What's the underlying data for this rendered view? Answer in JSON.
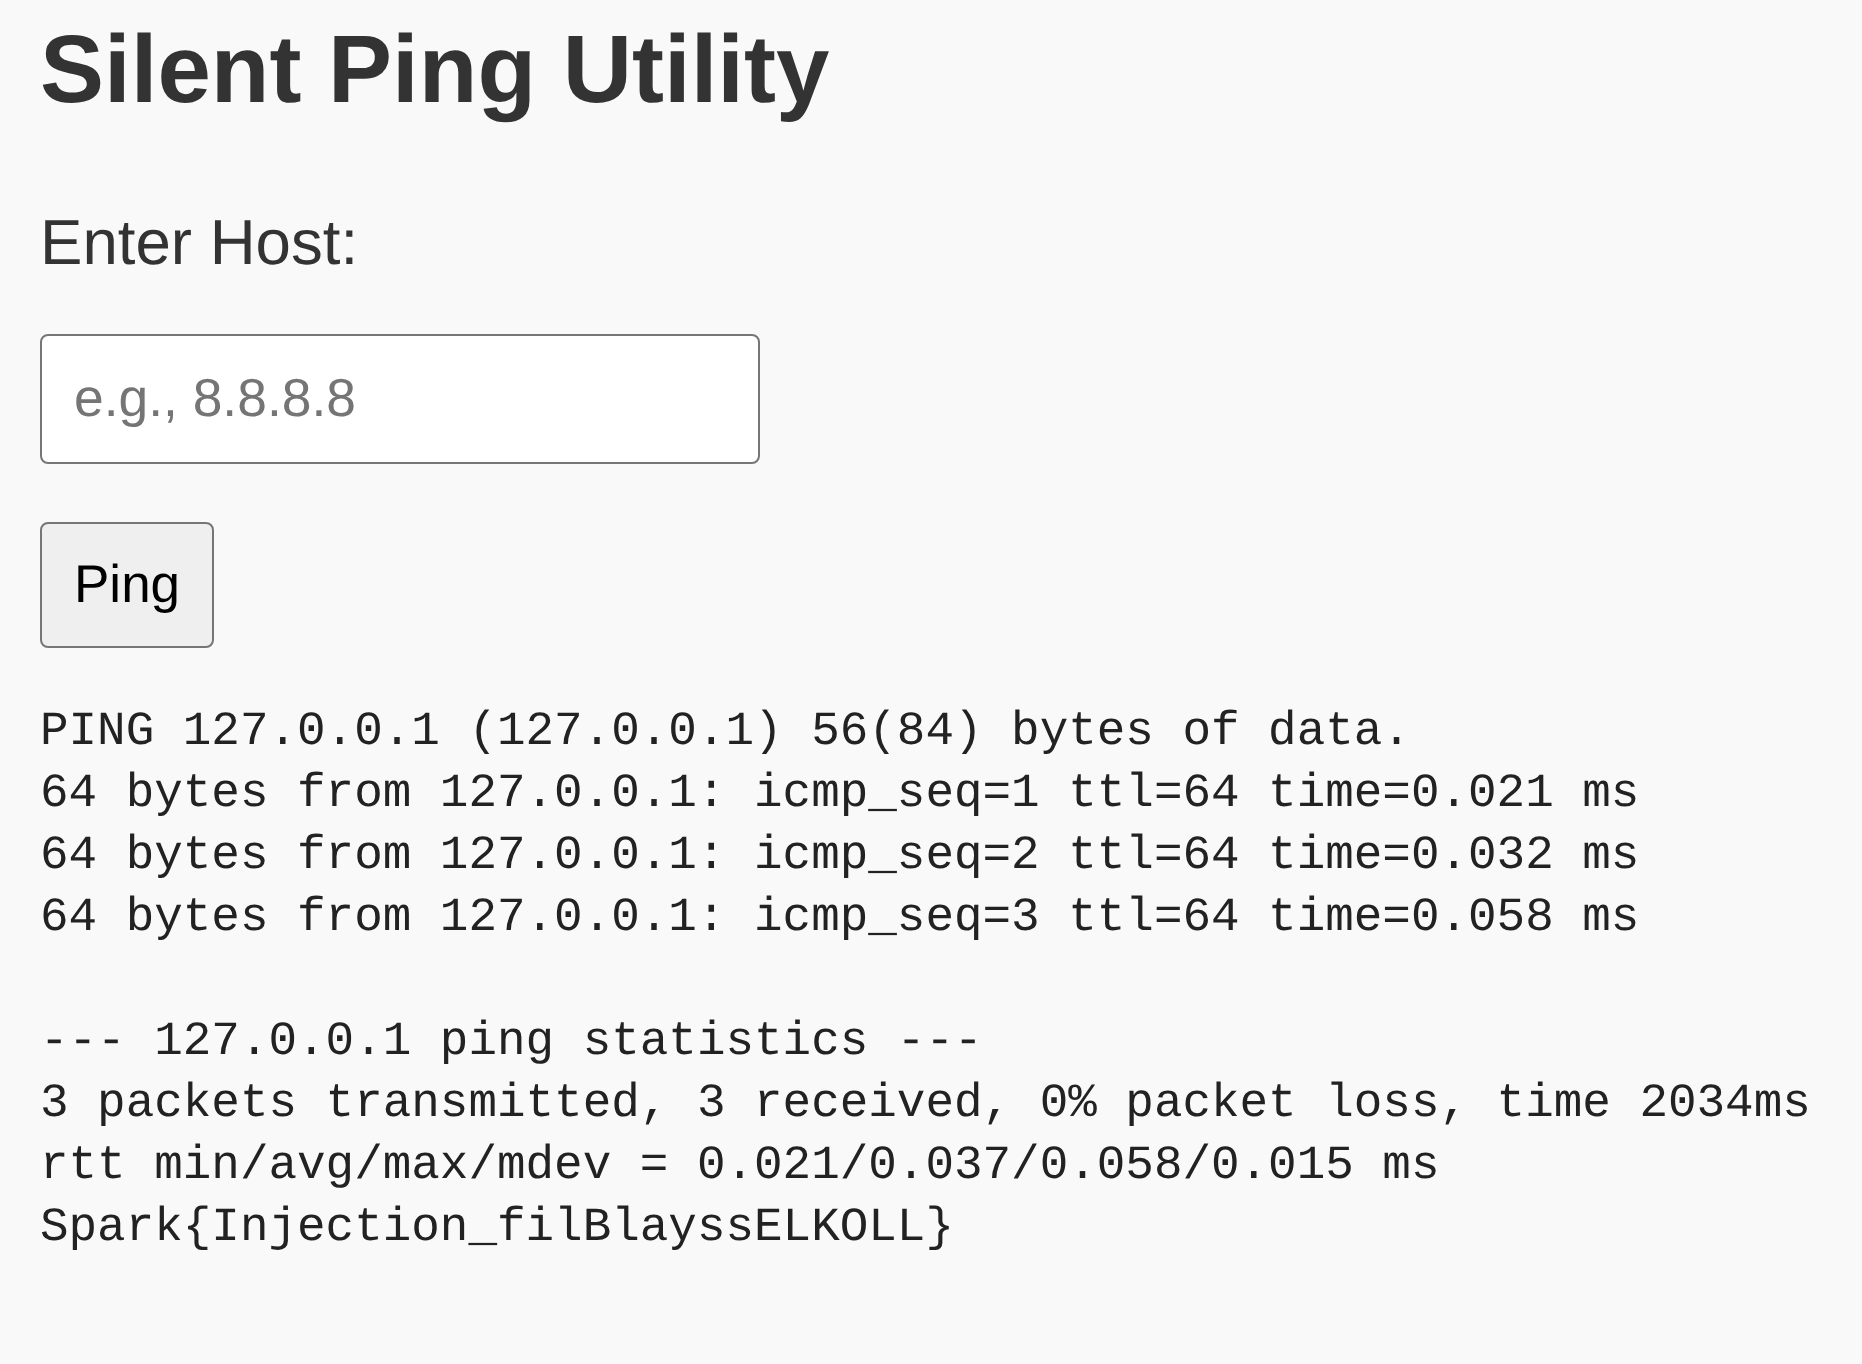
{
  "title": "Silent Ping Utility",
  "host_field": {
    "label": "Enter Host:",
    "placeholder": "e.g., 8.8.8.8"
  },
  "ping_button": {
    "label": "Ping"
  },
  "output": [
    {
      "lines": [
        "PING 127.0.0.1 (127.0.0.1) 56(84) bytes of data.",
        "64 bytes from 127.0.0.1: icmp_seq=1 ttl=64 time=0.021 ms",
        "64 bytes from 127.0.0.1: icmp_seq=2 ttl=64 time=0.032 ms",
        "64 bytes from 127.0.0.1: icmp_seq=3 ttl=64 time=0.058 ms"
      ]
    },
    {
      "lines": [
        "--- 127.0.0.1 ping statistics ---",
        "3 packets transmitted, 3 received, 0% packet loss, time 2034ms",
        "rtt min/avg/max/mdev = 0.021/0.037/0.058/0.015 ms",
        "Spark{Injection_filBlayssELKOLL}"
      ]
    }
  ]
}
